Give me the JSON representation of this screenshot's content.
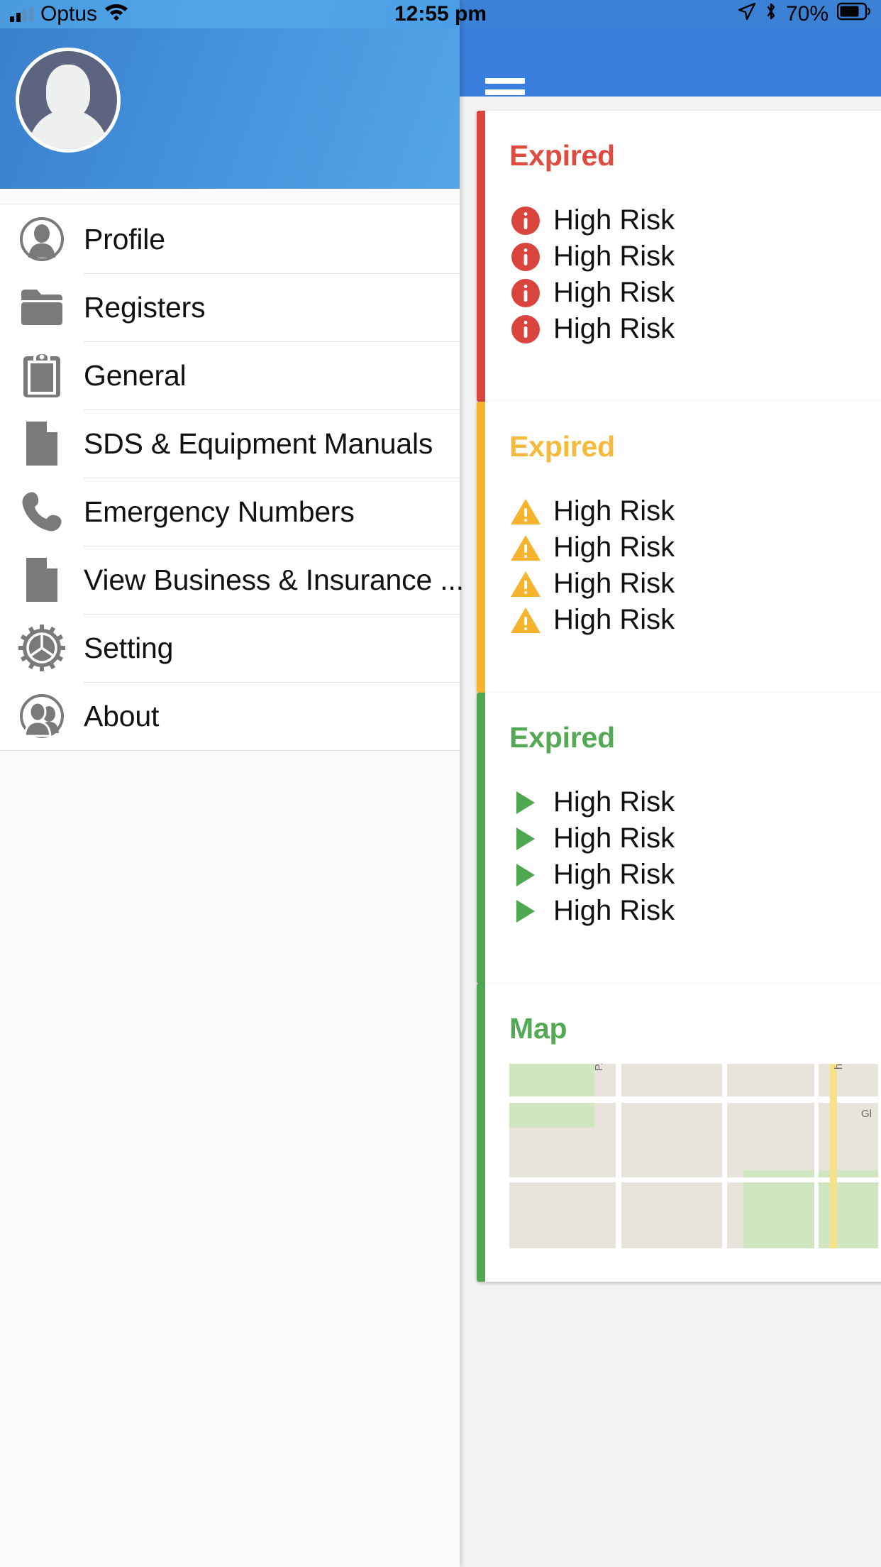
{
  "status_bar": {
    "carrier": "Optus",
    "time": "12:55 pm",
    "battery_percent": "70%",
    "icons": [
      "signal-bars-icon",
      "wifi-icon",
      "location-arrow-icon",
      "bluetooth-icon",
      "battery-icon"
    ]
  },
  "drawer": {
    "avatar_icon": "user-avatar-placeholder",
    "items": [
      {
        "label": "Profile",
        "icon": "person-circle-icon"
      },
      {
        "label": "Registers",
        "icon": "folder-icon"
      },
      {
        "label": "General",
        "icon": "clipboard-icon"
      },
      {
        "label": "SDS & Equipment Manuals",
        "icon": "document-icon"
      },
      {
        "label": "Emergency Numbers",
        "icon": "phone-icon"
      },
      {
        "label": "View Business & Insurance ...",
        "icon": "document-icon"
      },
      {
        "label": "Setting",
        "icon": "gear-icon"
      },
      {
        "label": "About",
        "icon": "people-circle-icon"
      }
    ]
  },
  "dashboard": {
    "menu_icon": "hamburger-menu-icon",
    "cards": [
      {
        "title": "Expired",
        "accent": "#d9453c",
        "title_color": "#e04b3f",
        "row_icon": "info-circle-icon",
        "rows": [
          "High Risk",
          "High Risk",
          "High Risk",
          "High Risk"
        ]
      },
      {
        "title": "Expired",
        "accent": "#f5b32e",
        "title_color": "#f6b93b",
        "row_icon": "warning-triangle-icon",
        "rows": [
          "High Risk",
          "High Risk",
          "High Risk",
          "High Risk"
        ]
      },
      {
        "title": "Expired",
        "accent": "#4fa84f",
        "title_color": "#54a954",
        "row_icon": "play-triangle-icon",
        "rows": [
          "High Risk",
          "High Risk",
          "High Risk",
          "High Risk"
        ]
      },
      {
        "title": "Map",
        "accent": "#4fa84f",
        "title_color": "#54a954",
        "row_icon": "map-thumbnail-icon",
        "rows": [],
        "map_labels": [
          "h Nun E",
          "Gl",
          "PAR"
        ]
      }
    ]
  }
}
